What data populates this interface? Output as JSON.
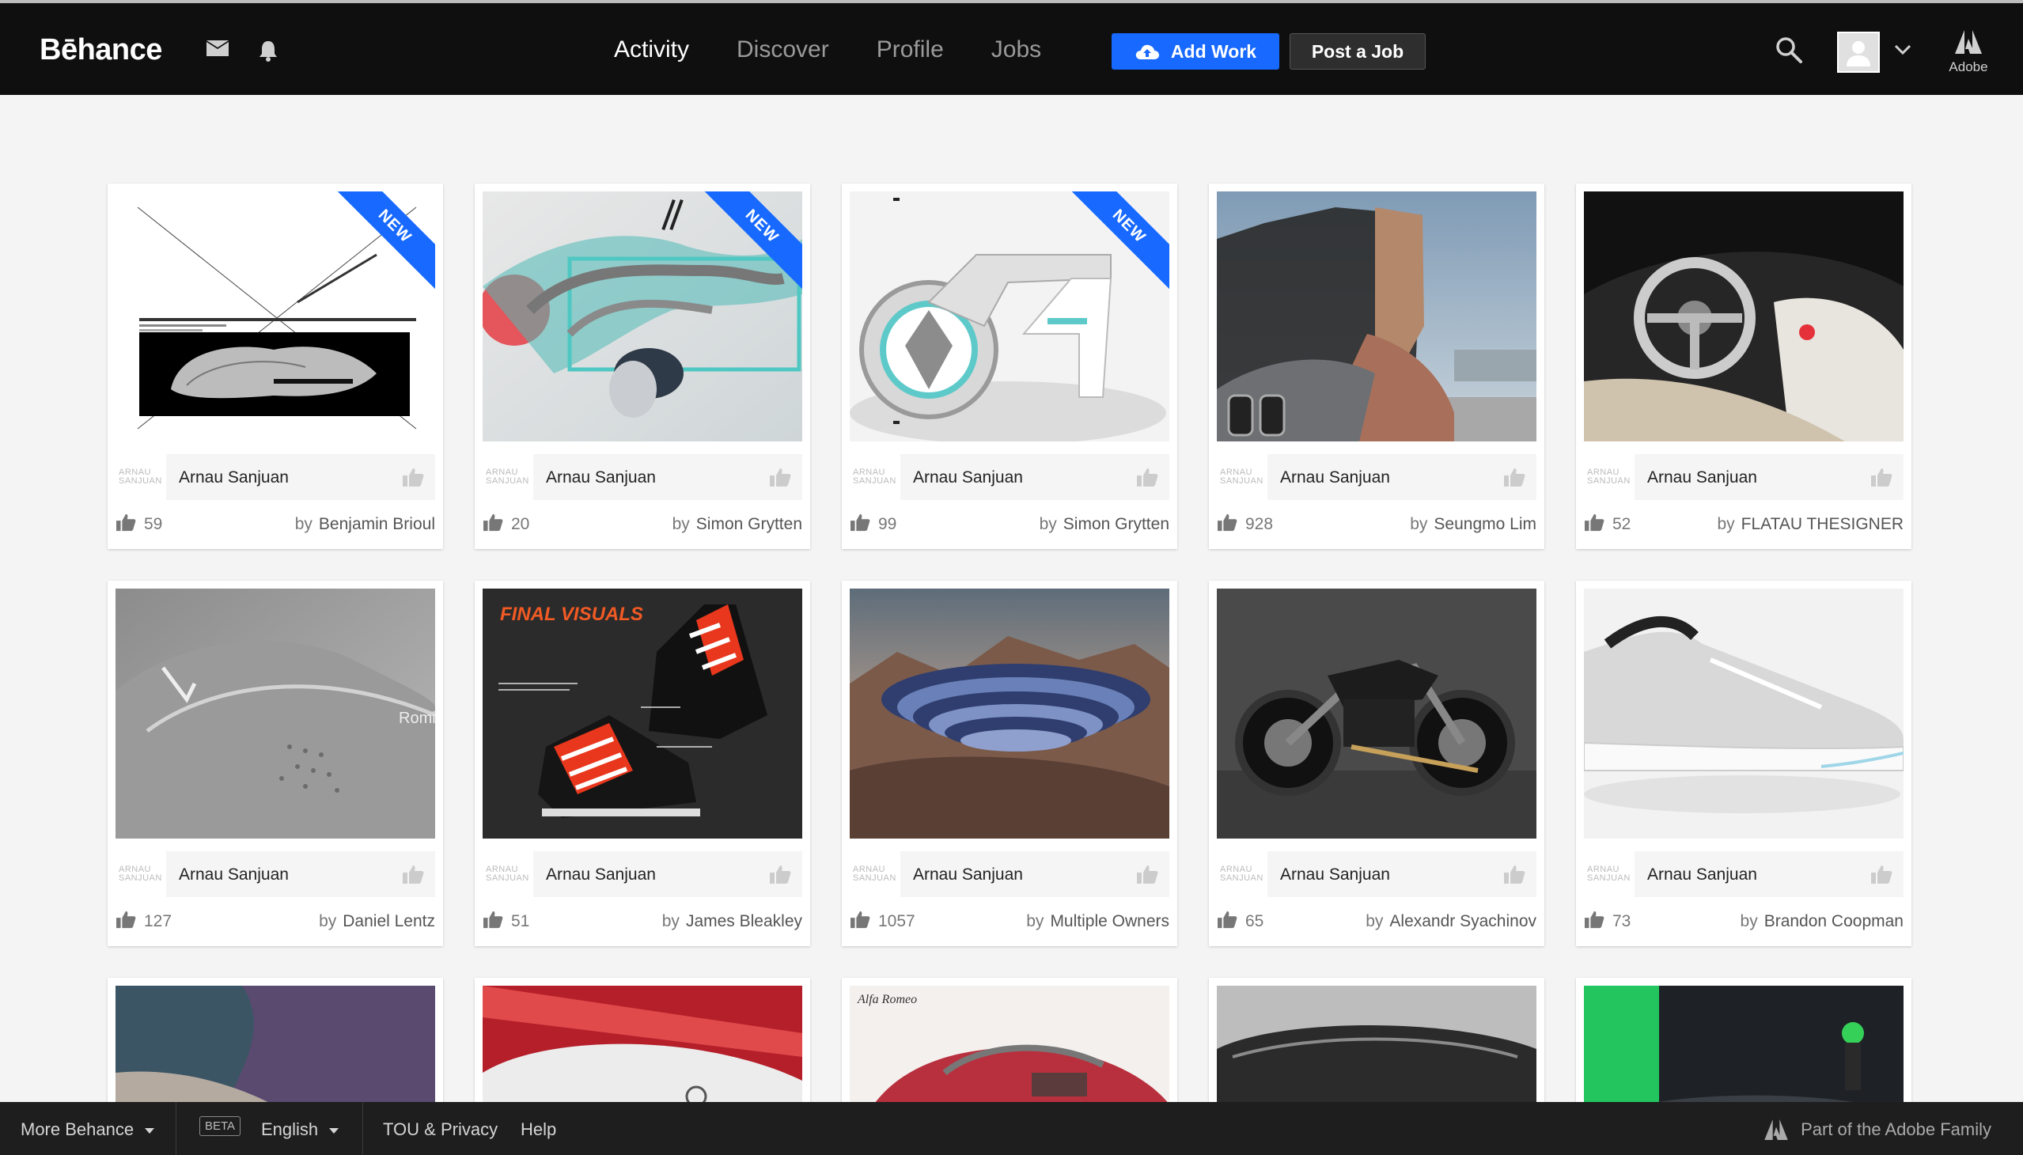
{
  "header": {
    "logo": "Bēhance",
    "nav": [
      {
        "label": "Activity",
        "active": true
      },
      {
        "label": "Discover",
        "active": false
      },
      {
        "label": "Profile",
        "active": false
      },
      {
        "label": "Jobs",
        "active": false
      }
    ],
    "add_work_label": "Add Work",
    "post_job_label": "Post a Job",
    "adobe_label": "Adobe",
    "accent_color": "#1769ff"
  },
  "new_badge": "NEW",
  "owner_logo": "ARNAU SANJUAN",
  "by_word": "by",
  "cards": [
    {
      "owner": "Arnau Sanjuan",
      "likes": "59",
      "author": "Benjamin Brioul",
      "is_new": true
    },
    {
      "owner": "Arnau Sanjuan",
      "likes": "20",
      "author": "Simon Grytten",
      "is_new": true
    },
    {
      "owner": "Arnau Sanjuan",
      "likes": "99",
      "author": "Simon Grytten",
      "is_new": true
    },
    {
      "owner": "Arnau Sanjuan",
      "likes": "928",
      "author": "Seungmo Lim",
      "is_new": false
    },
    {
      "owner": "Arnau Sanjuan",
      "likes": "52",
      "author": "FLATAU THESIGNER",
      "is_new": false
    },
    {
      "owner": "Arnau Sanjuan",
      "likes": "127",
      "author": "Daniel Lentz",
      "is_new": false
    },
    {
      "owner": "Arnau Sanjuan",
      "likes": "51",
      "author": "James Bleakley",
      "is_new": false
    },
    {
      "owner": "Arnau Sanjuan",
      "likes": "1057",
      "author": "Multiple Owners",
      "is_new": false
    },
    {
      "owner": "Arnau Sanjuan",
      "likes": "65",
      "author": "Alexandr Syachinov",
      "is_new": false
    },
    {
      "owner": "Arnau Sanjuan",
      "likes": "73",
      "author": "Brandon Coopman",
      "is_new": false
    }
  ],
  "thumb_texts": {
    "final_visuals": "FINAL VISUALS",
    "romi": "Romi",
    "alfa_romeo": "Alfa Romeo"
  },
  "footer": {
    "more": "More Behance",
    "beta": "BETA",
    "language": "English",
    "tou": "TOU & Privacy",
    "help": "Help",
    "adobe_family": "Part of the Adobe Family"
  }
}
